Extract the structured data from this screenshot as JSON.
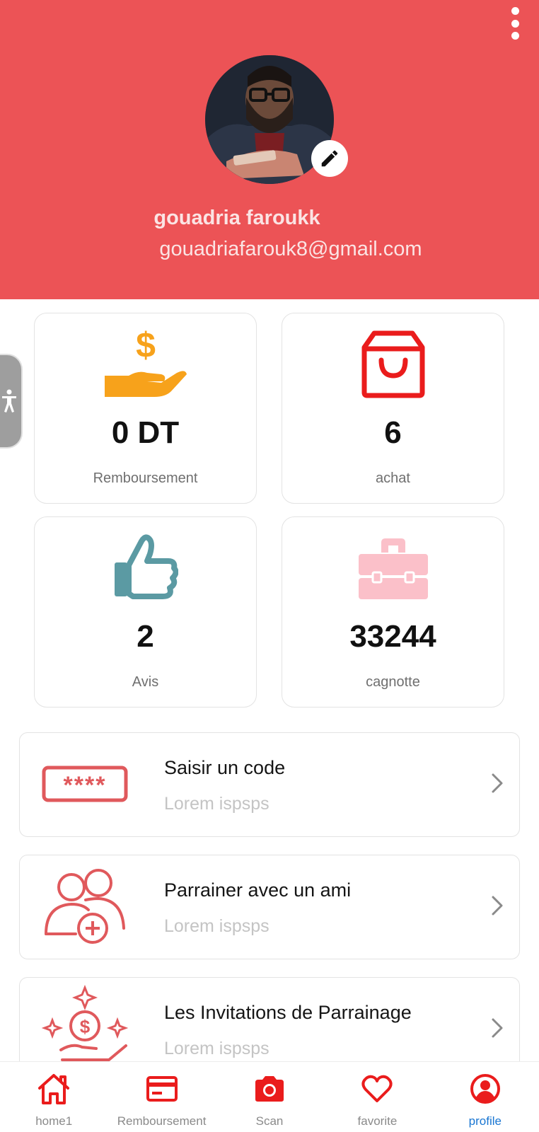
{
  "colors": {
    "header_bg": "#ec5356",
    "accent_red": "#ea1c1c",
    "icon_red": "#e0595c",
    "orange": "#f7a21b",
    "teal": "#5b9aa3",
    "pink": "#fbc0c9",
    "active_nav": "#1976d2"
  },
  "profile": {
    "name": "gouadria faroukk",
    "email": "gouadriafarouk8@gmail.com",
    "edit_icon": "pencil-icon",
    "menu_icon": "more-vertical-icon"
  },
  "accessibility": {
    "icon": "accessibility-icon"
  },
  "stats": [
    {
      "value": "0 DT",
      "label": "Remboursement",
      "icon": "hand-money-icon"
    },
    {
      "value": "6",
      "label": "achat",
      "icon": "shopping-bag-icon"
    },
    {
      "value": "2",
      "label": "Avis",
      "icon": "thumbs-up-icon"
    },
    {
      "value": "33244",
      "label": "cagnotte",
      "icon": "toolbox-icon"
    }
  ],
  "menu": [
    {
      "title": "Saisir un code",
      "subtitle": "Lorem ispsps",
      "icon": "password-code-icon"
    },
    {
      "title": "Parrainer avec un ami",
      "subtitle": "Lorem ispsps",
      "icon": "add-friends-icon"
    },
    {
      "title": "Les Invitations de Parrainage",
      "subtitle": "Lorem ispsps",
      "icon": "invitation-money-icon"
    }
  ],
  "nav": [
    {
      "label": "home1",
      "icon": "home-icon",
      "active": false
    },
    {
      "label": "Remboursement",
      "icon": "card-icon",
      "active": false
    },
    {
      "label": "Scan",
      "icon": "camera-icon",
      "active": false
    },
    {
      "label": "favorite",
      "icon": "heart-icon",
      "active": false
    },
    {
      "label": "profile",
      "icon": "user-circle-icon",
      "active": true
    }
  ]
}
